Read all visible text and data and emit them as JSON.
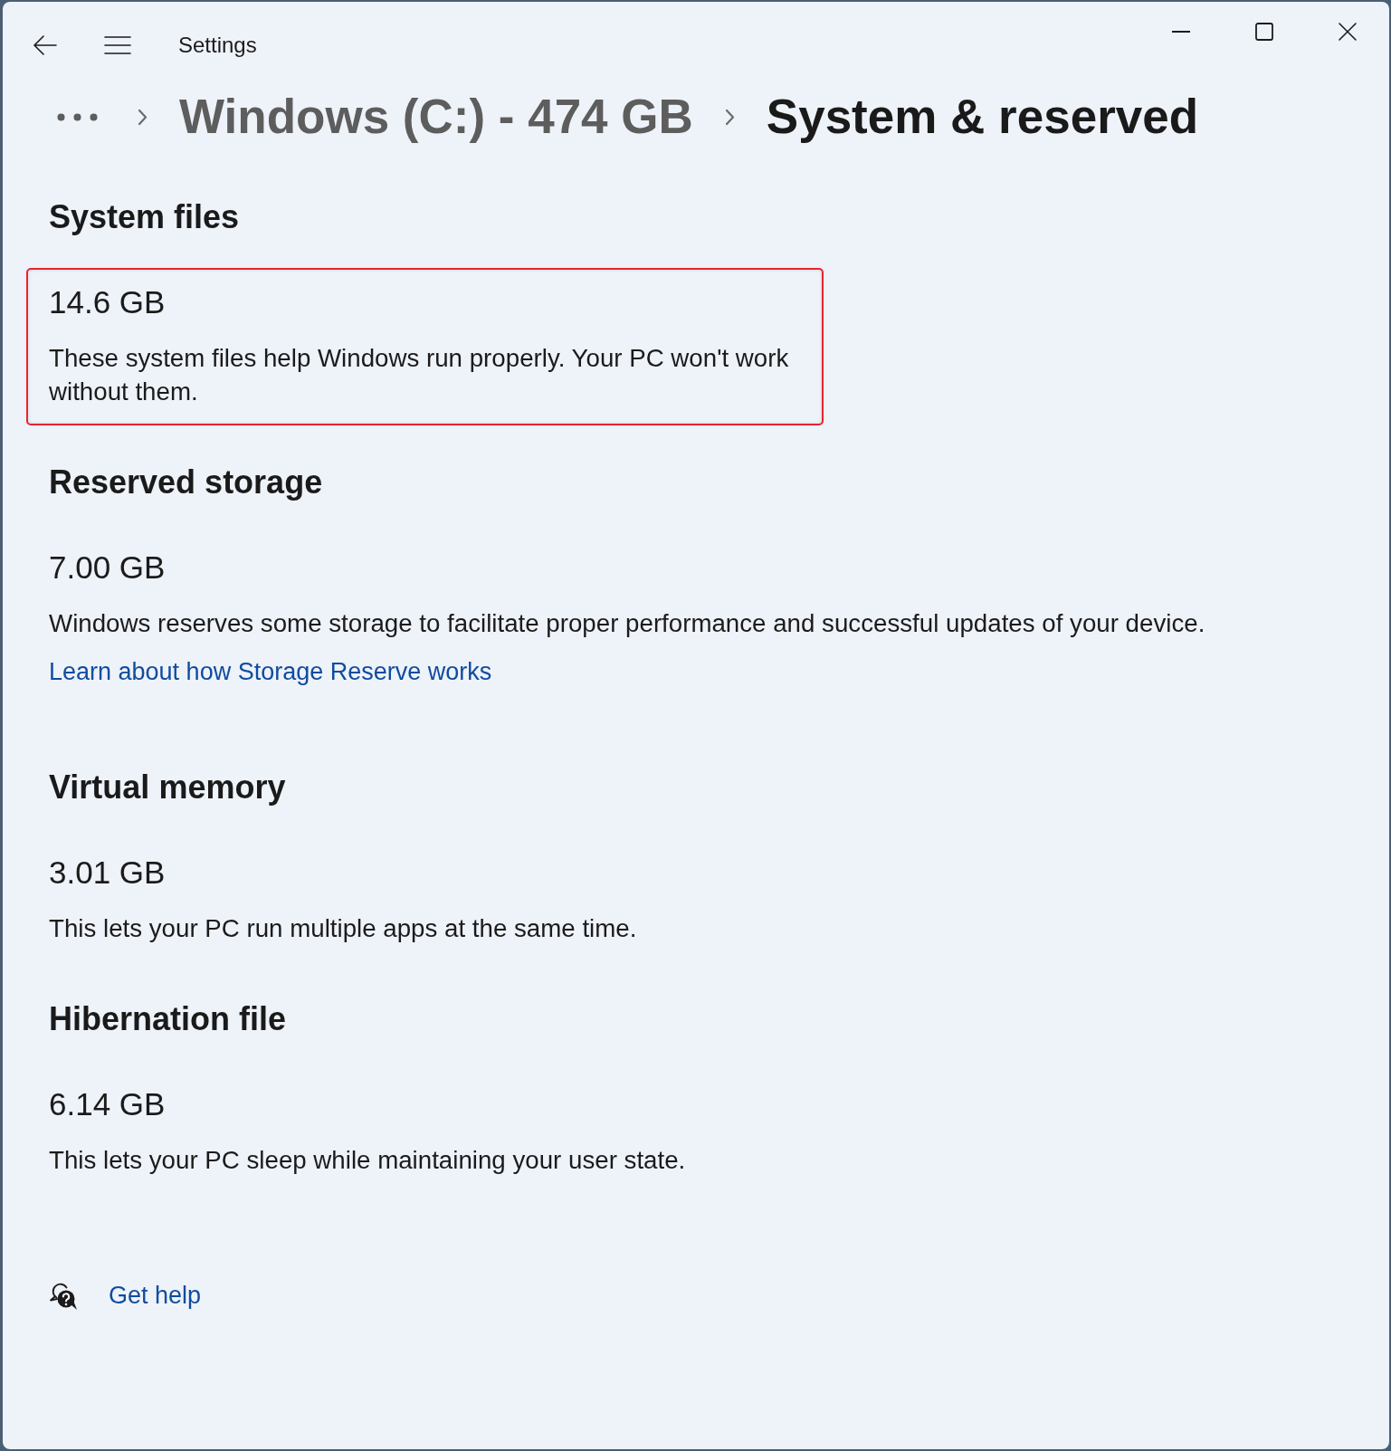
{
  "window": {
    "title": "Settings"
  },
  "breadcrumb": [
    {
      "label": "Windows (C:) - 474 GB",
      "current": false
    },
    {
      "label": "System & reserved",
      "current": true
    }
  ],
  "sections": [
    {
      "heading": "System files",
      "size": "14.6 GB",
      "description": "These system files help Windows run properly. Your PC won't work without them.",
      "highlighted": true
    },
    {
      "heading": "Reserved storage",
      "size": "7.00 GB",
      "description": "Windows reserves some storage to facilitate proper performance and successful updates of your device.",
      "link": "Learn about how Storage Reserve works",
      "highlighted": false
    },
    {
      "heading": "Virtual memory",
      "size": "3.01 GB",
      "description": "This lets your PC run multiple apps at the same time.",
      "highlighted": false
    },
    {
      "heading": "Hibernation file",
      "size": "6.14 GB",
      "description": "This lets your PC sleep while maintaining your user state.",
      "highlighted": false
    }
  ],
  "help": {
    "label": "Get help"
  }
}
